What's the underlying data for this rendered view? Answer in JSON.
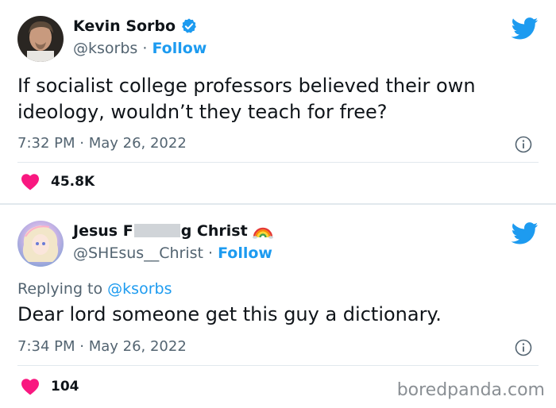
{
  "tweet1": {
    "author_name": "Kevin Sorbo",
    "handle": "@ksorbs",
    "separator": "·",
    "follow_label": "Follow",
    "text_line1": "If socialist college professors believed their own",
    "text_line2": "ideology, wouldn’t they teach for free?",
    "timestamp": "7:32 PM · May 26, 2022",
    "likes": "45.8K"
  },
  "tweet2": {
    "author_name_part1": "Jesus F",
    "author_name_part2": "g Christ",
    "handle": "@SHEsus__Christ",
    "separator": "·",
    "follow_label": "Follow",
    "replying_prefix": "Replying to",
    "replying_mention": "@ksorbs",
    "text": "Dear lord someone get this guy a dictionary.",
    "timestamp": "7:34 PM · May 26, 2022",
    "likes": "104"
  },
  "watermark": "boredpanda.com",
  "colors": {
    "twitter_blue": "#1d9bf0",
    "verified_blue": "#1d9bf0",
    "heart_red": "#f91880",
    "muted_text": "#536471",
    "divider": "#e1e8ed"
  },
  "icons": [
    "verified-badge-icon",
    "twitter-bird-icon",
    "info-icon",
    "heart-icon",
    "rainbow-emoji-icon"
  ]
}
